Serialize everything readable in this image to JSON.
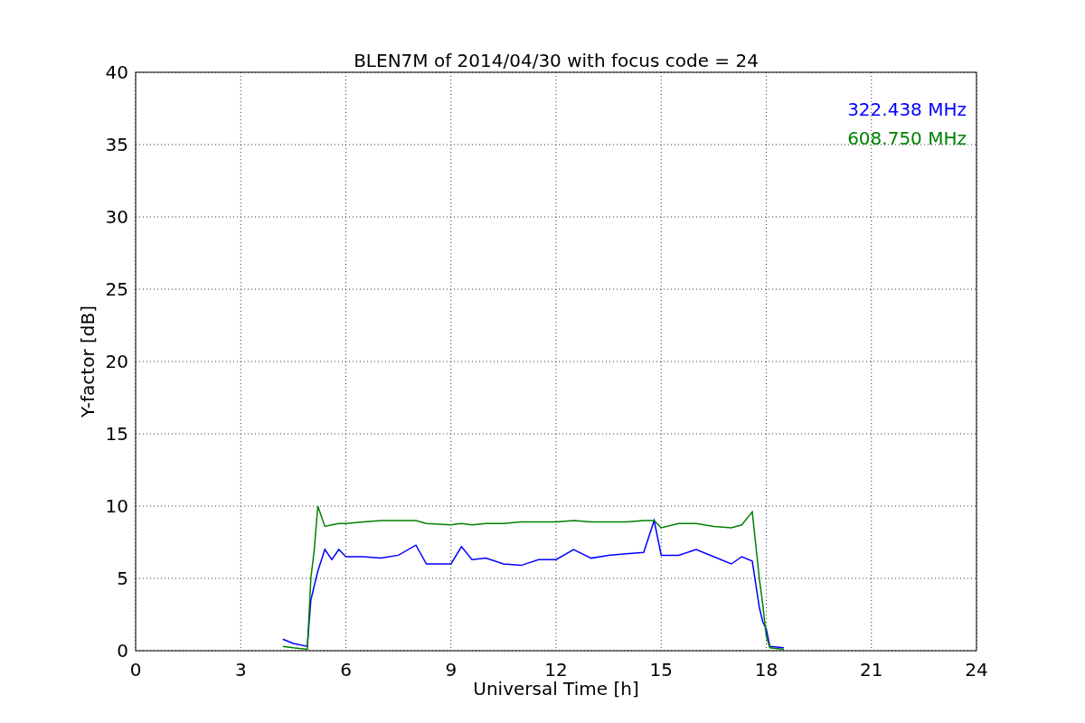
{
  "chart_data": {
    "type": "line",
    "title": "BLEN7M of 2014/04/30 with focus code = 24",
    "xlabel": "Universal Time [h]",
    "ylabel": "Y-factor [dB]",
    "x": [
      4.2,
      4.5,
      4.9,
      5.0,
      5.1,
      5.2,
      5.4,
      5.6,
      5.8,
      6,
      6.5,
      7,
      7.5,
      8,
      8.3,
      9,
      9.3,
      9.6,
      10,
      10.5,
      11,
      11.5,
      12,
      12.5,
      13,
      13.5,
      14,
      14.5,
      14.8,
      15,
      15.5,
      16,
      16.5,
      17,
      17.3,
      17.6,
      17.8,
      17.9,
      18,
      18.1,
      18.5
    ],
    "series": [
      {
        "name": "322.438 MHz",
        "color": "#0000ff",
        "values": [
          0.8,
          0.5,
          0.3,
          3.5,
          4.5,
          5.5,
          7,
          6.3,
          7,
          6.5,
          6.5,
          6.4,
          6.6,
          7.3,
          6,
          6,
          7.2,
          6.3,
          6.4,
          6,
          5.9,
          6.3,
          6.3,
          7,
          6.4,
          6.6,
          6.7,
          6.8,
          9.0,
          6.6,
          6.6,
          7,
          6.5,
          6,
          6.5,
          6.2,
          3,
          2,
          1.5,
          0.3,
          0.2
        ]
      },
      {
        "name": "608.750 MHz",
        "color": "#008000",
        "values": [
          0.3,
          0.2,
          0.1,
          5,
          7,
          10,
          8.6,
          8.7,
          8.8,
          8.8,
          8.9,
          9,
          9,
          9,
          8.8,
          8.7,
          8.8,
          8.7,
          8.8,
          8.8,
          8.9,
          8.9,
          8.9,
          9,
          8.9,
          8.9,
          8.9,
          9,
          9,
          8.5,
          8.8,
          8.8,
          8.6,
          8.5,
          8.7,
          9.6,
          5,
          3.2,
          1,
          0.2,
          0.1
        ]
      }
    ],
    "grid": true,
    "xlim": [
      0,
      24
    ],
    "ylim": [
      0,
      40
    ],
    "xticks": [
      0,
      3,
      6,
      9,
      12,
      15,
      18,
      21,
      24
    ],
    "yticks": [
      0,
      5,
      10,
      15,
      20,
      25,
      30,
      35,
      40
    ]
  }
}
